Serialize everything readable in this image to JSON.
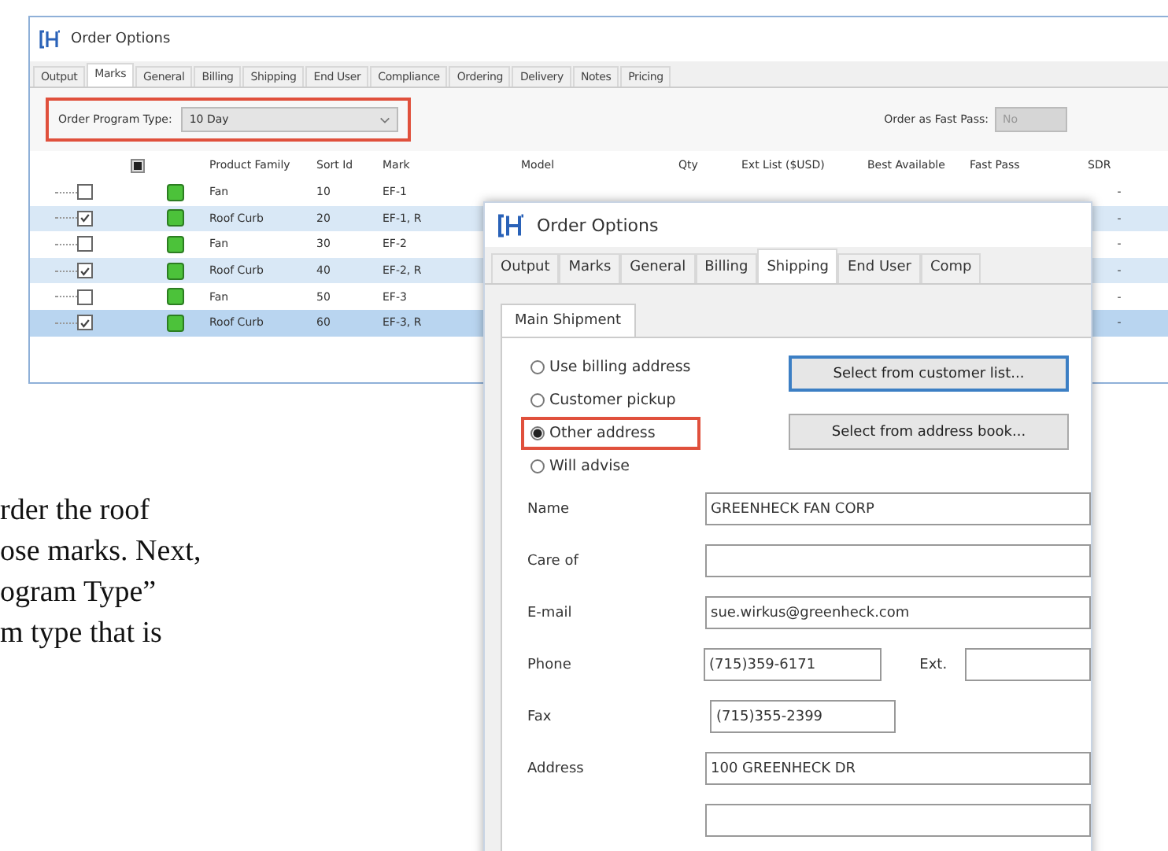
{
  "back_window": {
    "title": "Order Options",
    "tabs": [
      {
        "label": "Output",
        "selected": false
      },
      {
        "label": "Marks",
        "selected": true
      },
      {
        "label": "General",
        "selected": false
      },
      {
        "label": "Billing",
        "selected": false
      },
      {
        "label": "Shipping",
        "selected": false
      },
      {
        "label": "End User",
        "selected": false
      },
      {
        "label": "Compliance",
        "selected": false
      },
      {
        "label": "Ordering",
        "selected": false
      },
      {
        "label": "Delivery",
        "selected": false
      },
      {
        "label": "Notes",
        "selected": false
      },
      {
        "label": "Pricing",
        "selected": false
      }
    ],
    "program_type": {
      "label": "Order Program Type:",
      "value": "10 Day",
      "highlighted": true
    },
    "fast_pass": {
      "label": "Order as Fast Pass:",
      "value": "No",
      "disabled": true
    },
    "table": {
      "select_all": {
        "checked": true
      },
      "columns": [
        "Product Family",
        "Sort Id",
        "Mark",
        "Model",
        "Qty",
        "Ext List ($USD)",
        "Best Available",
        "Fast Pass",
        "SDR"
      ],
      "rows": [
        {
          "checked": false,
          "selected": false,
          "product_family": "Fan",
          "sort_id": "10",
          "mark": "EF-1",
          "sdr": "-"
        },
        {
          "checked": true,
          "selected": false,
          "product_family": "Roof Curb",
          "sort_id": "20",
          "mark": "EF-1, R",
          "sdr": "-"
        },
        {
          "checked": false,
          "selected": false,
          "product_family": "Fan",
          "sort_id": "30",
          "mark": "EF-2",
          "sdr": "-"
        },
        {
          "checked": true,
          "selected": false,
          "product_family": "Roof Curb",
          "sort_id": "40",
          "mark": "EF-2, R",
          "sdr": "-"
        },
        {
          "checked": false,
          "selected": false,
          "product_family": "Fan",
          "sort_id": "50",
          "mark": "EF-3",
          "sdr": "-"
        },
        {
          "checked": true,
          "selected": true,
          "product_family": "Roof Curb",
          "sort_id": "60",
          "mark": "EF-3, R",
          "sdr": "-"
        }
      ]
    }
  },
  "front_window": {
    "title": "Order Options",
    "tabs": [
      {
        "label": "Output",
        "selected": false
      },
      {
        "label": "Marks",
        "selected": false
      },
      {
        "label": "General",
        "selected": false
      },
      {
        "label": "Billing",
        "selected": false
      },
      {
        "label": "Shipping",
        "selected": true
      },
      {
        "label": "End User",
        "selected": false
      },
      {
        "label": "Comp",
        "selected": false
      }
    ],
    "subtab": {
      "label": "Main Shipment",
      "selected": true
    },
    "radios": [
      {
        "label": "Use billing address",
        "selected": false,
        "highlighted": false
      },
      {
        "label": "Customer pickup",
        "selected": false,
        "highlighted": false
      },
      {
        "label": "Other address",
        "selected": true,
        "highlighted": true
      },
      {
        "label": "Will advise",
        "selected": false,
        "highlighted": false
      }
    ],
    "buttons": [
      {
        "label": "Select from customer list...",
        "focused": true
      },
      {
        "label": "Select from address book...",
        "focused": false
      }
    ],
    "fields": [
      {
        "kind": "wide",
        "label": "Name",
        "value": "GREENHECK FAN CORP"
      },
      {
        "kind": "wide",
        "label": "Care of"
      },
      {
        "kind": "wide",
        "label": "E-mail",
        "value": "sue.wirkus@greenheck.com"
      },
      {
        "kind": "phone",
        "label": "Phone",
        "value": "(715)359-6171",
        "ext_label": "Ext."
      },
      {
        "kind": "short",
        "label": "Fax",
        "value": "(715)355-2399"
      },
      {
        "kind": "wide",
        "label": "Address",
        "value": "100 GREENHECK DR"
      },
      {
        "kind": "blank"
      }
    ]
  },
  "text_fragment": "rder the roof\nose marks. Next,\nogram Type”\nm type that is"
}
